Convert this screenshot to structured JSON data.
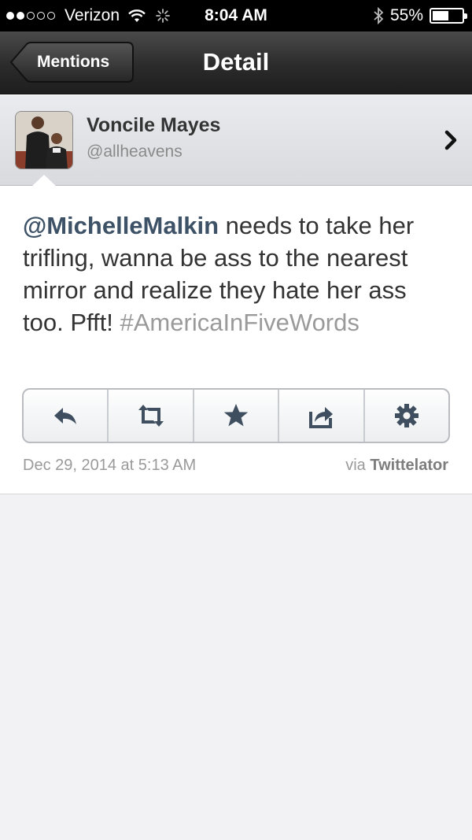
{
  "status_bar": {
    "carrier": "Verizon",
    "time": "8:04 AM",
    "battery": "55%",
    "battery_level": 0.55,
    "icons": [
      "signal-dots",
      "wifi-icon",
      "activity-spinner-icon",
      "bluetooth-icon",
      "battery-icon"
    ]
  },
  "nav": {
    "back_label": "Mentions",
    "title": "Detail"
  },
  "profile": {
    "name": "Voncile Mayes",
    "handle": "@allheavens"
  },
  "tweet": {
    "mention": "@MichelleMalkin",
    "text": " needs to take her trifling, wanna be ass to the nearest mirror and realize they hate her ass too. Pfft! ",
    "hashtag": "#AmericaInFiveWords",
    "date": "Dec 29, 2014 at 5:13 AM",
    "via_prefix": "via ",
    "via_app": "Twittelator"
  },
  "actions": [
    "reply-icon",
    "retweet-icon",
    "star-icon",
    "share-icon",
    "gear-icon"
  ],
  "colors": {
    "mention": "#3d5266",
    "hashtag": "#9a9a9a",
    "nav_bar": "#2b2b2b"
  }
}
